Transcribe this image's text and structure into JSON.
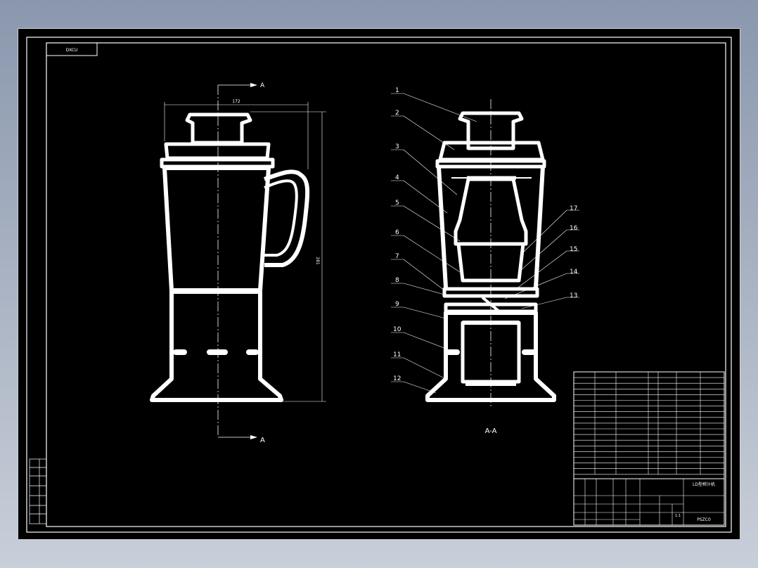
{
  "drawing_code": "DXCU",
  "section_label_top": "A",
  "section_label_bottom": "A",
  "section_view_label": "A-A",
  "dim_width": "172",
  "dim_height": "281",
  "parts": [
    "1",
    "2",
    "3",
    "4",
    "5",
    "6",
    "7",
    "8",
    "9",
    "10",
    "11",
    "12",
    "13",
    "14",
    "15",
    "16",
    "17"
  ],
  "title_block": {
    "product_name": "LD型榨汁机",
    "drawing_no": "PSZC0",
    "scale": "1:1"
  },
  "colors": {
    "line": "#ffffff",
    "background": "#000000",
    "frame": "#d0d0d0"
  }
}
